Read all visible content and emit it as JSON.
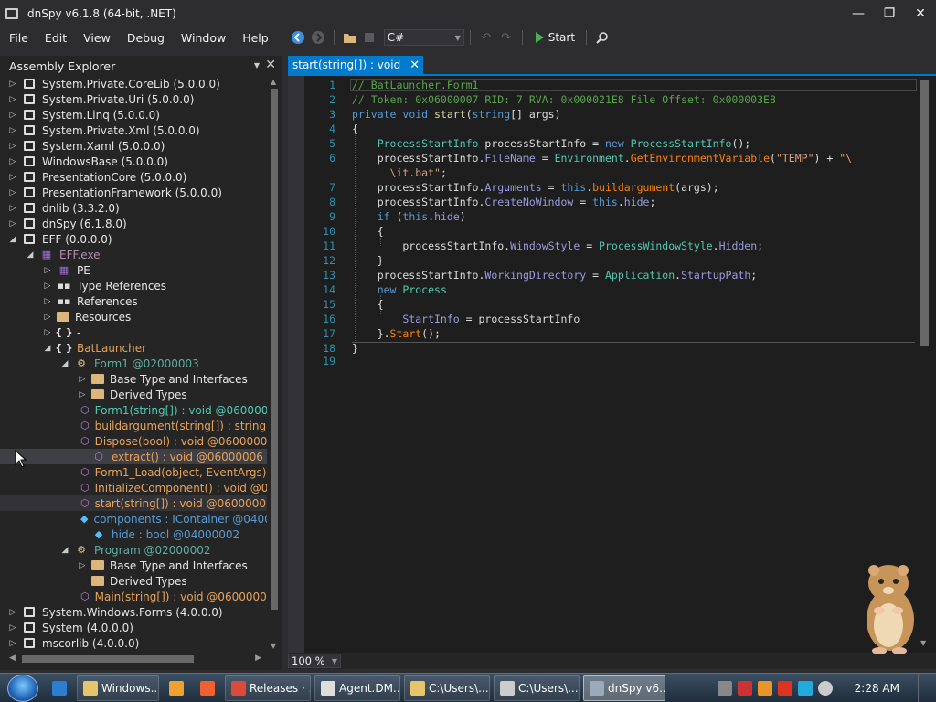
{
  "window": {
    "title": "dnSpy v6.1.8 (64-bit, .NET)",
    "minimize": "—",
    "maximize": "❐",
    "close": "✕"
  },
  "menu": {
    "items": [
      "File",
      "Edit",
      "View",
      "Debug",
      "Window",
      "Help"
    ]
  },
  "toolbar": {
    "back_icon": "◀",
    "forward_icon": "▶",
    "open_icon": "📂",
    "language": "C#",
    "undo_icon": "↶",
    "redo_icon": "↷",
    "start_label": "Start",
    "search_icon": "⚲"
  },
  "explorer": {
    "title": "Assembly Explorer",
    "pin": "▼",
    "close": "✕",
    "nodes": [
      {
        "text": "System.Private.CoreLib (5.0.0.0)",
        "exp": "▷",
        "icon": "asm",
        "color": "t-white"
      },
      {
        "text": "System.Private.Uri (5.0.0.0)",
        "exp": "▷",
        "icon": "asm",
        "color": "t-white"
      },
      {
        "text": "System.Linq (5.0.0.0)",
        "exp": "▷",
        "icon": "asm",
        "color": "t-white"
      },
      {
        "text": "System.Private.Xml (5.0.0.0)",
        "exp": "▷",
        "icon": "asm",
        "color": "t-white"
      },
      {
        "text": "System.Xaml (5.0.0.0)",
        "exp": "▷",
        "icon": "asm",
        "color": "t-white"
      },
      {
        "text": "WindowsBase (5.0.0.0)",
        "exp": "▷",
        "icon": "asm",
        "color": "t-white"
      },
      {
        "text": "PresentationCore (5.0.0.0)",
        "exp": "▷",
        "icon": "asm",
        "color": "t-white"
      },
      {
        "text": "PresentationFramework (5.0.0.0)",
        "exp": "▷",
        "icon": "asm",
        "color": "t-white"
      },
      {
        "text": "dnlib (3.3.2.0)",
        "exp": "▷",
        "icon": "asm",
        "color": "t-white"
      },
      {
        "text": "dnSpy (6.1.8.0)",
        "exp": "▷",
        "icon": "asm",
        "color": "t-white"
      },
      {
        "text": "EFF (0.0.0.0)",
        "exp": "◢",
        "icon": "asm",
        "color": "t-white"
      },
      {
        "text": "EFF.exe",
        "exp": "◢",
        "icon": "module",
        "color": "t-purple"
      },
      {
        "text": "PE",
        "exp": "▷",
        "icon": "module",
        "color": "t-white"
      },
      {
        "text": "Type References",
        "exp": "▷",
        "icon": "ref",
        "color": "t-white"
      },
      {
        "text": "References",
        "exp": "▷",
        "icon": "ref",
        "color": "t-white"
      },
      {
        "text": "Resources",
        "exp": "▷",
        "icon": "folder",
        "color": "t-white"
      },
      {
        "text": "-",
        "exp": "▷",
        "icon": "ns",
        "color": "t-white"
      },
      {
        "text": "BatLauncher",
        "exp": "◢",
        "icon": "ns",
        "color": "t-orange"
      },
      {
        "text": "Form1 @02000003",
        "exp": "◢",
        "icon": "class",
        "color": "t-green"
      },
      {
        "text": "Base Type and Interfaces",
        "exp": "▷",
        "icon": "folder",
        "color": "t-white"
      },
      {
        "text": "Derived Types",
        "exp": "▷",
        "icon": "folder",
        "color": "t-white"
      },
      {
        "text": "Form1(string[]) : void @06000004",
        "exp": "",
        "icon": "method",
        "color": "t-teal"
      },
      {
        "text": "buildargument(string[]) : string @",
        "exp": "",
        "icon": "method",
        "color": "t-orange"
      },
      {
        "text": "Dispose(bool) : void @06000002",
        "exp": "",
        "icon": "method",
        "color": "t-orange"
      },
      {
        "text": "extract() : void @06000006",
        "exp": "",
        "icon": "method",
        "color": "t-orange"
      },
      {
        "text": "Form1_Load(object, EventArgs) :",
        "exp": "",
        "icon": "method",
        "color": "t-orange"
      },
      {
        "text": "InitializeComponent() : void @06",
        "exp": "",
        "icon": "method",
        "color": "t-orange"
      },
      {
        "text": "start(string[]) : void @06000007",
        "exp": "",
        "icon": "method",
        "color": "t-orange"
      },
      {
        "text": "components : IContainer @0400",
        "exp": "",
        "icon": "field",
        "color": "t-blue"
      },
      {
        "text": "hide : bool @04000002",
        "exp": "",
        "icon": "field",
        "color": "t-blue"
      },
      {
        "text": "Program @02000002",
        "exp": "◢",
        "icon": "class",
        "color": "t-green"
      },
      {
        "text": "Base Type and Interfaces",
        "exp": "▷",
        "icon": "folder",
        "color": "t-white"
      },
      {
        "text": "Derived Types",
        "exp": "",
        "icon": "folder",
        "color": "t-white"
      },
      {
        "text": "Main(string[]) : void @06000001",
        "exp": "",
        "icon": "method",
        "color": "t-orange"
      },
      {
        "text": "System.Windows.Forms (4.0.0.0)",
        "exp": "▷",
        "icon": "asm",
        "color": "t-white"
      },
      {
        "text": "System (4.0.0.0)",
        "exp": "▷",
        "icon": "asm",
        "color": "t-white"
      },
      {
        "text": "mscorlib (4.0.0.0)",
        "exp": "▷",
        "icon": "asm",
        "color": "t-white"
      }
    ]
  },
  "editor": {
    "tab_title": "start(string[]) : void",
    "tab_close": "✕",
    "zoom": "100 %"
  },
  "code": [
    {
      "ln": "1",
      "spans": [
        [
          "c",
          "// BatLauncher.Form1"
        ]
      ]
    },
    {
      "ln": "2",
      "spans": [
        [
          "c",
          "// Token: 0x06000007 RID: 7 RVA: 0x000021E8 File Offset: 0x000003E8"
        ]
      ]
    },
    {
      "ln": "3",
      "spans": [
        [
          "k",
          "private "
        ],
        [
          "k",
          "void "
        ],
        [
          "m",
          "start"
        ],
        [
          "p",
          "("
        ],
        [
          "k",
          "string"
        ],
        [
          "p",
          "[] args)"
        ]
      ]
    },
    {
      "ln": "4",
      "spans": [
        [
          "p",
          "{"
        ]
      ]
    },
    {
      "ln": "5",
      "spans": [
        [
          "p",
          "    "
        ],
        [
          "ty",
          "ProcessStartInfo"
        ],
        [
          "p",
          " processStartInfo = "
        ],
        [
          "k",
          "new "
        ],
        [
          "ty",
          "ProcessStartInfo"
        ],
        [
          "p",
          "();"
        ]
      ]
    },
    {
      "ln": "6",
      "spans": [
        [
          "p",
          "    processStartInfo."
        ],
        [
          "pr",
          "FileName"
        ],
        [
          "p",
          " = "
        ],
        [
          "ty",
          "Environment"
        ],
        [
          "p",
          "."
        ],
        [
          "fn",
          "GetEnvironmentVariable"
        ],
        [
          "p",
          "("
        ],
        [
          "s",
          "\"TEMP\""
        ],
        [
          "p",
          ") + "
        ],
        [
          "s",
          "\"\\"
        ]
      ]
    },
    {
      "ln": "",
      "spans": [
        [
          "s",
          "      \\it.bat\""
        ],
        [
          "p",
          ";"
        ]
      ]
    },
    {
      "ln": "7",
      "spans": [
        [
          "p",
          "    processStartInfo."
        ],
        [
          "pr",
          "Arguments"
        ],
        [
          "p",
          " = "
        ],
        [
          "k",
          "this"
        ],
        [
          "p",
          "."
        ],
        [
          "fn",
          "buildargument"
        ],
        [
          "p",
          "(args);"
        ]
      ]
    },
    {
      "ln": "8",
      "spans": [
        [
          "p",
          "    processStartInfo."
        ],
        [
          "pr",
          "CreateNoWindow"
        ],
        [
          "p",
          " = "
        ],
        [
          "k",
          "this"
        ],
        [
          "p",
          "."
        ],
        [
          "pr",
          "hide"
        ],
        [
          "p",
          ";"
        ]
      ]
    },
    {
      "ln": "9",
      "spans": [
        [
          "p",
          "    "
        ],
        [
          "k",
          "if"
        ],
        [
          "p",
          " ("
        ],
        [
          "k",
          "this"
        ],
        [
          "p",
          "."
        ],
        [
          "pr",
          "hide"
        ],
        [
          "p",
          ")"
        ]
      ]
    },
    {
      "ln": "10",
      "spans": [
        [
          "p",
          "    {"
        ]
      ]
    },
    {
      "ln": "11",
      "spans": [
        [
          "p",
          "        processStartInfo."
        ],
        [
          "pr",
          "WindowStyle"
        ],
        [
          "p",
          " = "
        ],
        [
          "ty",
          "ProcessWindowStyle"
        ],
        [
          "p",
          "."
        ],
        [
          "pr",
          "Hidden"
        ],
        [
          "p",
          ";"
        ]
      ]
    },
    {
      "ln": "12",
      "spans": [
        [
          "p",
          "    }"
        ]
      ]
    },
    {
      "ln": "13",
      "spans": [
        [
          "p",
          "    processStartInfo."
        ],
        [
          "pr",
          "WorkingDirectory"
        ],
        [
          "p",
          " = "
        ],
        [
          "ty",
          "Application"
        ],
        [
          "p",
          "."
        ],
        [
          "pr",
          "StartupPath"
        ],
        [
          "p",
          ";"
        ]
      ]
    },
    {
      "ln": "14",
      "spans": [
        [
          "p",
          "    "
        ],
        [
          "k",
          "new "
        ],
        [
          "ty",
          "Process"
        ]
      ]
    },
    {
      "ln": "15",
      "spans": [
        [
          "p",
          "    {"
        ]
      ]
    },
    {
      "ln": "16",
      "spans": [
        [
          "p",
          "        "
        ],
        [
          "pr",
          "StartInfo"
        ],
        [
          "p",
          " = processStartInfo"
        ]
      ]
    },
    {
      "ln": "17",
      "spans": [
        [
          "p",
          "    }."
        ],
        [
          "fn",
          "Start"
        ],
        [
          "p",
          "();"
        ]
      ]
    },
    {
      "ln": "18",
      "spans": [
        [
          "p",
          "}"
        ]
      ]
    },
    {
      "ln": "19",
      "spans": []
    }
  ],
  "taskbar": {
    "tasks": [
      {
        "label": "",
        "icon_color": "#2b7fd0",
        "pinned": true
      },
      {
        "label": "Windows...",
        "icon_color": "#e6c46a"
      },
      {
        "label": "",
        "icon_color": "#f0a030",
        "pinned": true
      },
      {
        "label": "",
        "icon_color": "#f06030",
        "pinned": true
      },
      {
        "label": "Releases · ...",
        "icon_color": "#de4a3a"
      },
      {
        "label": "Agent.DM...",
        "icon_color": "#dddddd"
      },
      {
        "label": "C:\\Users\\...",
        "icon_color": "#e6c46a"
      },
      {
        "label": "C:\\Users\\...",
        "icon_color": "#cccccc"
      },
      {
        "label": "dnSpy v6....",
        "icon_color": "#9ab",
        "active": true
      }
    ],
    "clock": "2:28 AM"
  }
}
